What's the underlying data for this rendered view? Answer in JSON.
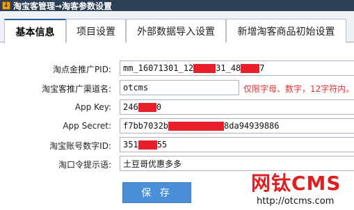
{
  "window": {
    "title": "淘宝客管理→淘客参数设置",
    "icon": "download-arrow-icon"
  },
  "tabs": [
    {
      "label": "基本信息",
      "active": true
    },
    {
      "label": "项目设置",
      "active": false
    },
    {
      "label": "外部数据导入设置",
      "active": false
    },
    {
      "label": "新增淘客商品初始设置",
      "active": false
    }
  ],
  "form": {
    "pid": {
      "label": "淘点金推广PID:",
      "value_a": "mm_16071301_12",
      "value_b": "31_48",
      "value_c": "7"
    },
    "channel": {
      "label": "淘宝客推广渠道名:",
      "value": "otcms",
      "hint": "仅限字母、数字，12字符内。"
    },
    "app_key": {
      "label": "App Key:",
      "value_a": "246",
      "value_b": "0"
    },
    "app_secret": {
      "label": "App Secret:",
      "value_a": "f7bb7032b",
      "value_b": "8da94939886"
    },
    "account_id": {
      "label": "淘宝账号数字ID:",
      "value_a": "351",
      "value_b": "55"
    },
    "password_hint": {
      "label": "淘口令提示语:",
      "value": "土豆哥优惠多多"
    }
  },
  "save_button": "保 存",
  "watermark": {
    "brand": "网钛CMS",
    "url": "http://otcms.com"
  },
  "colors": {
    "title_bar": "#2c3f54",
    "save_button": "#4a90d9",
    "redaction": "#e8202a",
    "hint": "#e03030"
  }
}
